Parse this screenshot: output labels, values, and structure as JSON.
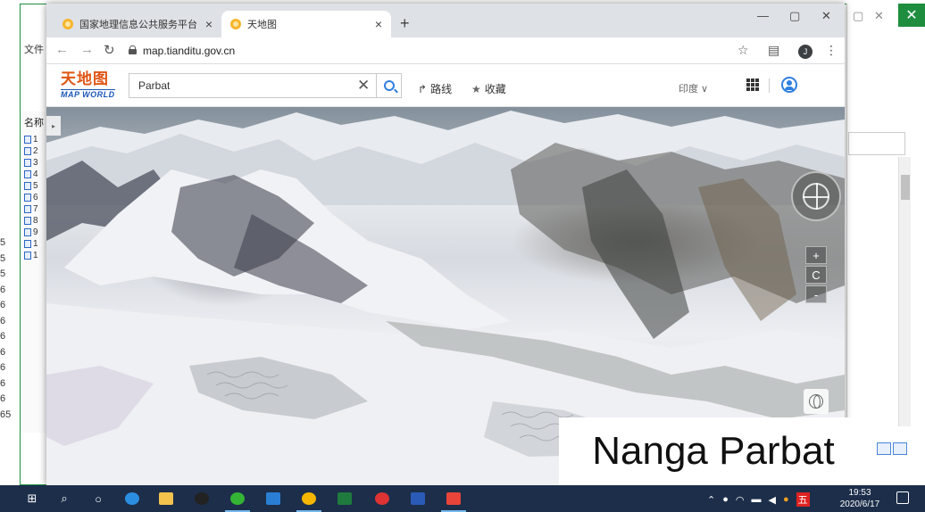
{
  "browser": {
    "tabs": [
      {
        "title": "国家地理信息公共服务平台 天地",
        "active": false
      },
      {
        "title": "天地图",
        "active": true
      }
    ],
    "url": "map.tianditu.gov.cn",
    "profile_initial": "J"
  },
  "site": {
    "logo_cn": "天地图",
    "logo_en": "MAP WORLD",
    "search_value": "Parbat",
    "route_label": "路线",
    "favorites_label": "收藏",
    "region_label": "印度 ∨"
  },
  "map": {
    "zoom_in": "+",
    "reset": "C",
    "zoom_out": "-"
  },
  "caption": "Nanga Parbat",
  "background_app": {
    "ribbon_tab": "文件",
    "column_header": "名称",
    "left_numbers": [
      "5",
      "5",
      "5",
      "6",
      "6",
      "6",
      "6",
      "6",
      "6",
      "6",
      "6",
      "65"
    ],
    "row_labels": [
      "1",
      "2",
      "3",
      "4",
      "5",
      "6",
      "7",
      "8",
      "9",
      "1",
      "1"
    ]
  },
  "taskbar": {
    "time": "19:53",
    "date": "2020/6/17"
  },
  "colors": {
    "accent": "#2f7fe0",
    "logo_orange": "#e05515",
    "taskbar": "#1c2e4a",
    "bg_window_border": "#1e8e3e"
  }
}
